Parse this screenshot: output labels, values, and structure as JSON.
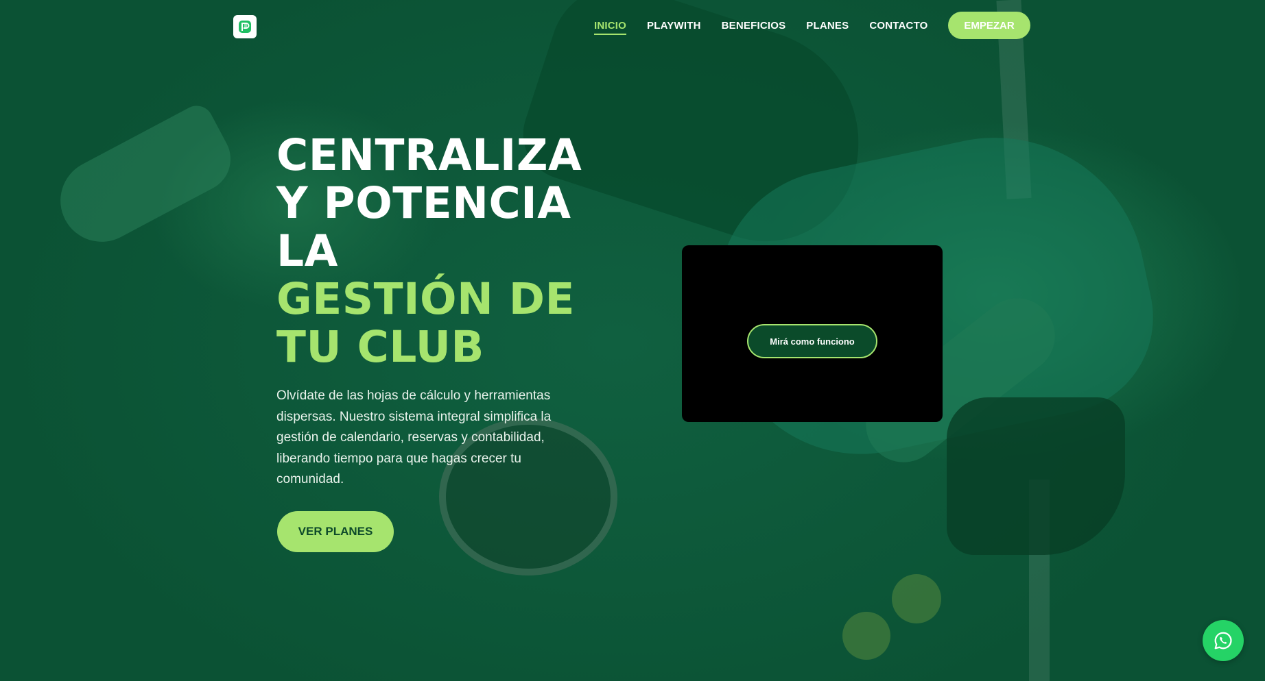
{
  "brand": {
    "logo_icon": "playwith-logo-icon",
    "accent_color": "#a6e46e",
    "background_color": "#0d5a37"
  },
  "nav": {
    "links": [
      {
        "label": "INICIO",
        "active": true
      },
      {
        "label": "PLAYWITH",
        "active": false
      },
      {
        "label": "BENEFICIOS",
        "active": false
      },
      {
        "label": "PLANES",
        "active": false
      },
      {
        "label": "CONTACTO",
        "active": false
      }
    ],
    "cta_label": "EMPEZAR"
  },
  "hero": {
    "title_lines": [
      "CENTRALIZA",
      "Y POTENCIA",
      "LA"
    ],
    "title_accent_lines": [
      "GESTIÓN DE",
      "TU CLUB"
    ],
    "description": "Olvídate de las hojas de cálculo y herramientas dispersas. Nuestro sistema integral simplifica la gestión de calendario, reservas y contabilidad, liberando tiempo para que hagas crecer tu comunidad.",
    "cta_label": "VER PLANES"
  },
  "video": {
    "button_label": "Mirá como funciono"
  },
  "floating": {
    "whatsapp_icon": "whatsapp-icon",
    "whatsapp_color": "#25d366"
  }
}
